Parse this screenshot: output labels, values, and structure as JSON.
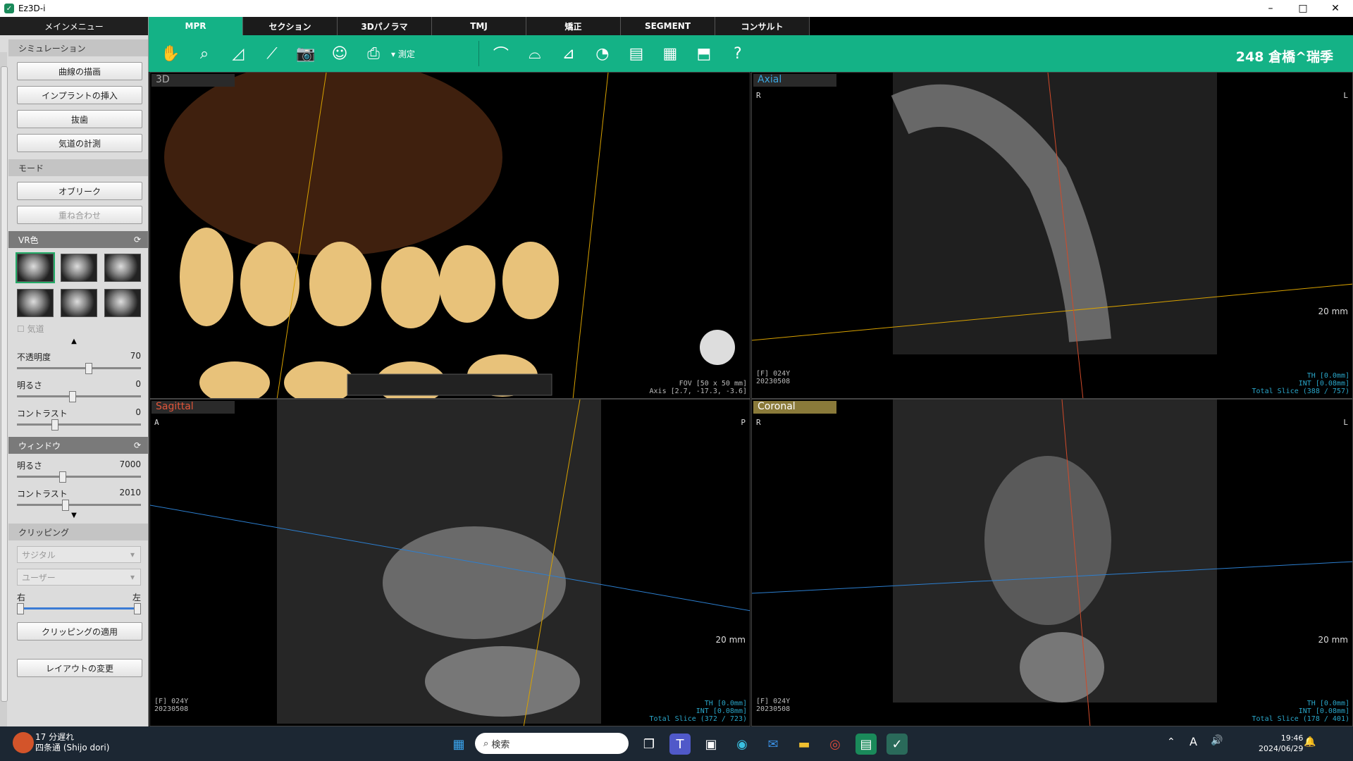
{
  "window": {
    "title": "Ez3D-i",
    "min": "–",
    "max": "□",
    "close": "✕"
  },
  "sidebar": {
    "header": "メインメニュー",
    "sections": {
      "simulation": {
        "title": "シミュレーション",
        "buttons": [
          "曲線の描画",
          "インプラントの挿入",
          "抜歯",
          "気道の計測"
        ]
      },
      "mode": {
        "title": "モード",
        "buttons": [
          "オブリーク",
          "重ね合わせ"
        ]
      },
      "vr": {
        "title": "VR色",
        "checkbox": "気道"
      },
      "sliders": [
        {
          "label": "不透明度",
          "value": "70",
          "level": 0.58
        },
        {
          "label": "明るさ",
          "value": "0",
          "level": 0.44
        },
        {
          "label": "コントラスト",
          "value": "0",
          "level": 0.29
        }
      ],
      "window": {
        "title": "ウィンドウ",
        "sliders": [
          {
            "label": "明るさ",
            "value": "7000",
            "level": 0.36
          },
          {
            "label": "コントラスト",
            "value": "2010",
            "level": 0.38
          }
        ]
      },
      "clipping": {
        "title": "クリッピング",
        "combo1": "サジタル",
        "combo2": "ユーザー",
        "left": "右",
        "right": "左",
        "apply": "クリッピングの適用"
      },
      "layout": "レイアウトの変更"
    }
  },
  "tabs": [
    "MPR",
    "セクション",
    "3Dパノラマ",
    "TMJ",
    "矯正",
    "SEGMENT",
    "コンサルト"
  ],
  "toolbar": {
    "measure": "測定",
    "patient": "248 倉橋^瑞季"
  },
  "viewports": {
    "v3d": {
      "label": "3D",
      "fov": "FOV [50 x 50 mm]",
      "axis": "Axis [2.7, -17.3, -3.6]"
    },
    "axial": {
      "label": "Axial",
      "left": "R",
      "right": "L",
      "scale": "20 mm",
      "id": "[F] 024Y",
      "date": "20230508",
      "th": "TH [0.0mm]",
      "int": "INT [0.08mm]",
      "total": "Total Slice (388 / 757)"
    },
    "sagittal": {
      "label": "Sagittal",
      "left": "A",
      "right": "P",
      "scale": "20 mm",
      "id": "[F] 024Y",
      "date": "20230508",
      "th": "TH [0.0mm]",
      "int": "INT [0.08mm]",
      "total": "Total Slice (372 / 723)"
    },
    "coronal": {
      "label": "Coronal",
      "left": "R",
      "right": "L",
      "scale": "20 mm",
      "id": "[F] 024Y",
      "date": "20230508",
      "th": "TH [0.0mm]",
      "int": "INT [0.08mm]",
      "total": "Total Slice (178 / 401)"
    }
  },
  "taskbar": {
    "weather_alert": "17 分遅れ",
    "weather_place": "四条通 (Shijo dori)",
    "search": "検索",
    "time": "19:46",
    "date": "2024/06/29",
    "lang": "A"
  }
}
